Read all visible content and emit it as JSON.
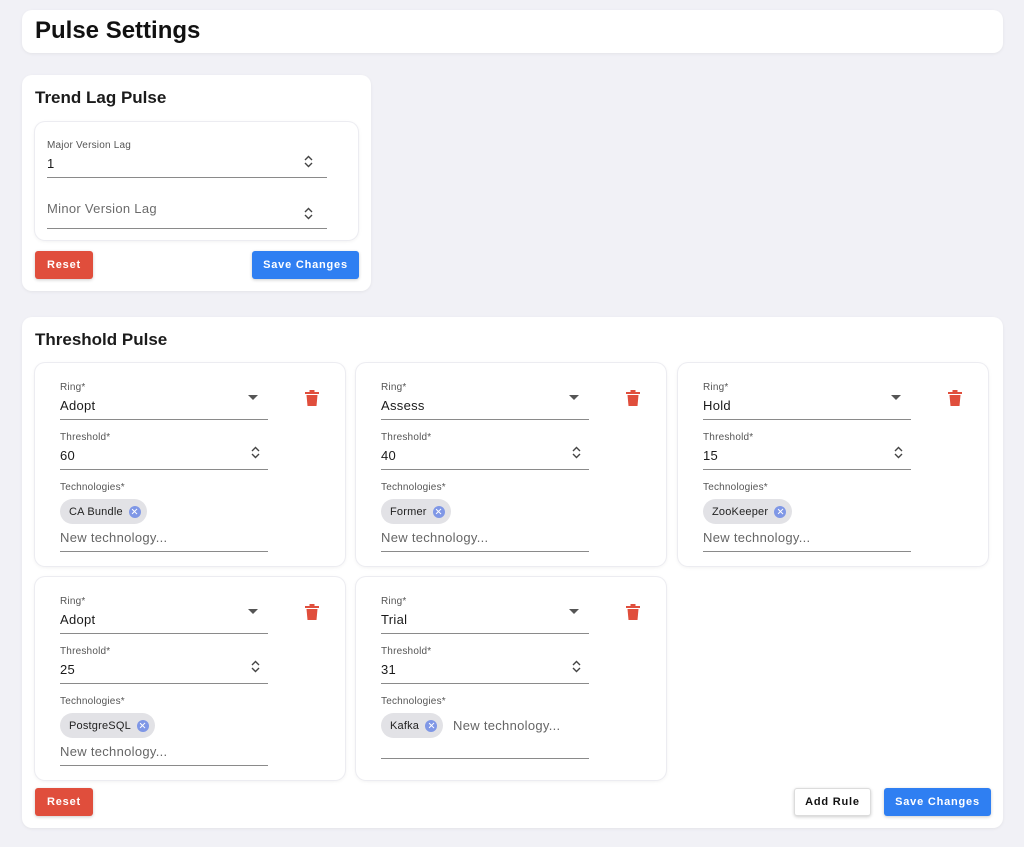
{
  "page": {
    "title": "Pulse Settings"
  },
  "colors": {
    "reset": "#e04e3c",
    "save": "#2f7ff2",
    "trash": "#e04e3c",
    "chip_remove": "#7f97e6"
  },
  "trend_lag": {
    "title": "Trend Lag Pulse",
    "major": {
      "label": "Major Version Lag",
      "value": "1"
    },
    "minor": {
      "placeholder": "Minor Version Lag"
    },
    "reset_label": "Reset",
    "save_label": "Save Changes"
  },
  "threshold": {
    "title": "Threshold Pulse",
    "ring_label": "Ring*",
    "threshold_label": "Threshold*",
    "tech_label": "Technologies*",
    "new_tech_placeholder": "New technology...",
    "rules": [
      {
        "ring": "Adopt",
        "threshold": "60",
        "technologies": [
          "CA Bundle"
        ]
      },
      {
        "ring": "Assess",
        "threshold": "40",
        "technologies": [
          "Former"
        ]
      },
      {
        "ring": "Hold",
        "threshold": "15",
        "technologies": [
          "ZooKeeper"
        ]
      },
      {
        "ring": "Adopt",
        "threshold": "25",
        "technologies": [
          "PostgreSQL"
        ]
      },
      {
        "ring": "Trial",
        "threshold": "31",
        "technologies": [
          "Kafka"
        ]
      }
    ],
    "reset_label": "Reset",
    "add_rule_label": "Add Rule",
    "save_label": "Save Changes"
  },
  "icons": {
    "trash": "trash-icon",
    "dropdown": "dropdown-arrow-icon",
    "spinner": "spinner-icon",
    "chip_remove": "chip-remove-icon"
  }
}
